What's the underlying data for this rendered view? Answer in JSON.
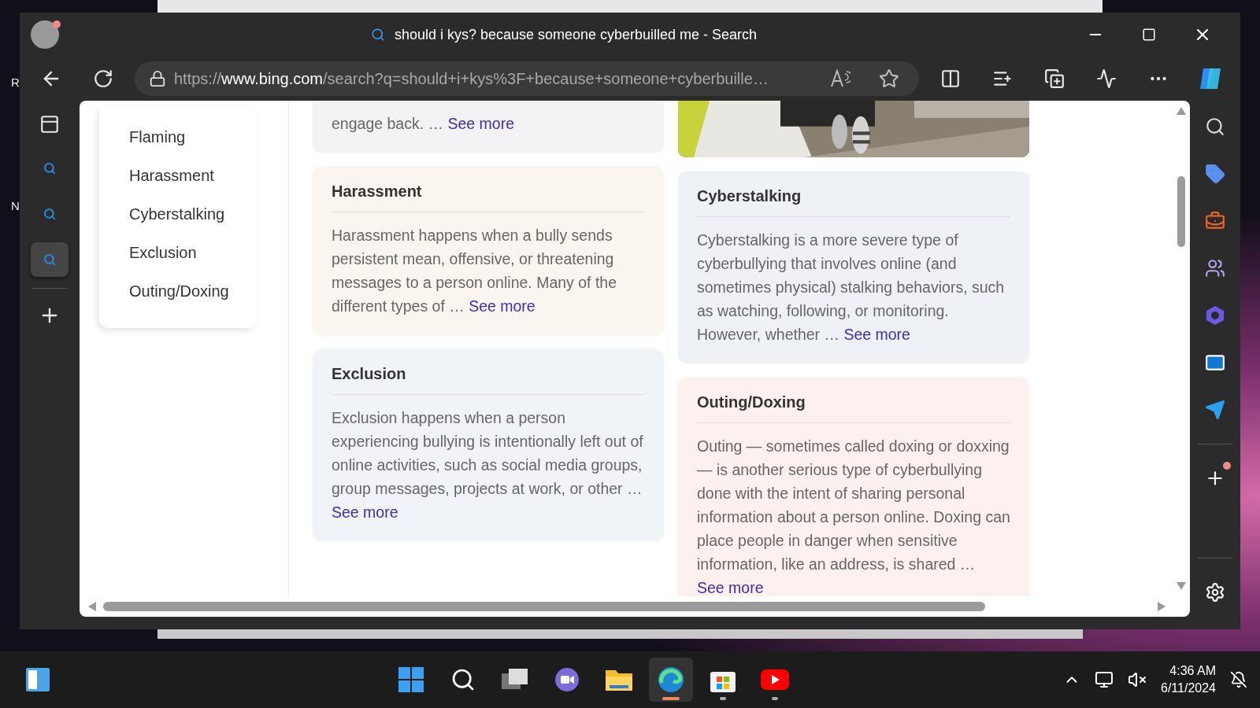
{
  "desktop_labels": [
    "R",
    "N"
  ],
  "window": {
    "title": "should i kys? because someone cyberbuilled me - Search"
  },
  "address_bar": {
    "scheme": "https://",
    "domain": "www.bing.com",
    "path": "/search?q=should+i+kys%3F+because+someone+cyberbuille…"
  },
  "vertical_tabs": [
    {
      "selected": false
    },
    {
      "selected": false
    },
    {
      "selected": true
    }
  ],
  "side_nav": [
    {
      "label": "Flaming"
    },
    {
      "label": "Harassment"
    },
    {
      "label": "Cyberstalking"
    },
    {
      "label": "Exclusion"
    },
    {
      "label": "Outing/Doxing"
    }
  ],
  "columns": [
    [
      {
        "kind": "snippet",
        "color": "#f3f3f5",
        "body": "engage back. …",
        "link": "See more"
      },
      {
        "kind": "card",
        "color": "#faf5ef",
        "title": "Harassment",
        "body": "Harassment happens when a bully sends persistent mean, offensive, or threatening messages to a person online. Many of the different types of …",
        "link": "See more"
      },
      {
        "kind": "card",
        "color": "#f0f4f8",
        "title": "Exclusion",
        "body": "Exclusion happens when a person experiencing bullying is intentionally left out of online activities, such as social media groups, group messages, projects at work, or other …",
        "link": "See more"
      }
    ],
    [
      {
        "kind": "picture"
      },
      {
        "kind": "card",
        "color": "#eef1f5",
        "title": "Cyberstalking",
        "body": "Cyberstalking is a more severe type of cyberbullying that involves online (and sometimes physical) stalking behaviors, such as watching, following, or monitoring. However, whether …",
        "link": "See more"
      },
      {
        "kind": "card",
        "color": "#fcf1ee",
        "title": "Outing/Doxing",
        "body": "Outing — sometimes called doxing or doxxing — is another serious type of cyberbullying done with the intent of sharing personal information about a person online. Doxing can place people in danger when sensitive information, like an address, is shared …",
        "link": "See more"
      }
    ]
  ],
  "taskbar_apps": [
    {
      "active": false,
      "running": false
    },
    {
      "active": false,
      "running": false
    },
    {
      "active": false,
      "running": false
    },
    {
      "active": false,
      "running": false
    },
    {
      "active": false,
      "running": false
    },
    {
      "active": true,
      "running": true
    },
    {
      "active": false,
      "running": true
    },
    {
      "active": false,
      "running": true
    }
  ],
  "clock": {
    "time": "4:36 AM",
    "date": "6/11/2024"
  }
}
